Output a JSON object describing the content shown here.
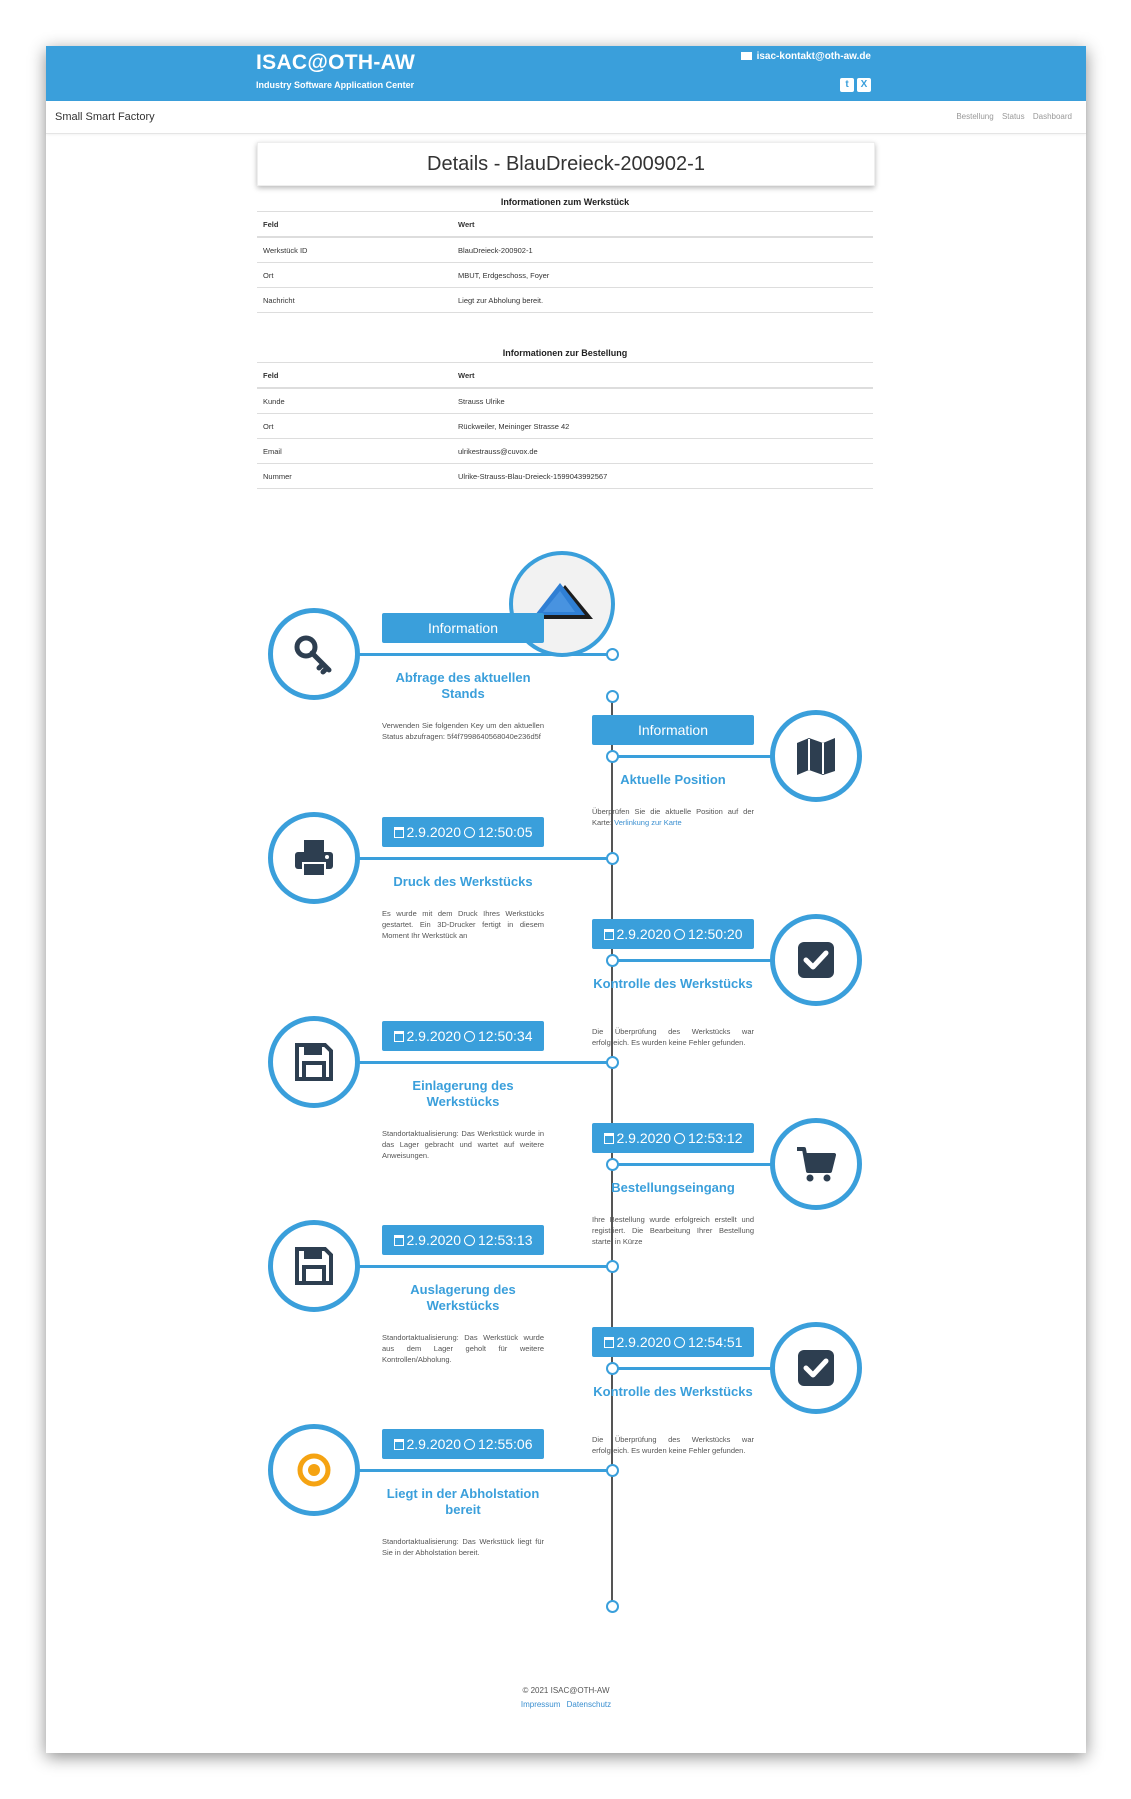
{
  "header": {
    "brand_title": "ISAC@OTH-AW",
    "brand_subtitle": "Industry Software Application Center",
    "contact_email": "isac-kontakt@oth-aw.de",
    "accent_color": "#3a9fdb"
  },
  "navbar": {
    "brand": "Small Smart Factory",
    "links": [
      "Bestellung",
      "Status",
      "Dashboard"
    ]
  },
  "page_title": "Details - BlauDreieck-200902-1",
  "werkstueck_table": {
    "caption": "Informationen zum Werkstück",
    "headers": [
      "Feld",
      "Wert"
    ],
    "rows": [
      [
        "Werkstück ID",
        "BlauDreieck-200902-1"
      ],
      [
        "Ort",
        "MBUT, Erdgeschoss, Foyer"
      ],
      [
        "Nachricht",
        "Liegt zur Abholung bereit."
      ]
    ]
  },
  "bestellung_table": {
    "caption": "Informationen zur Bestellung",
    "headers": [
      "Feld",
      "Wert"
    ],
    "rows": [
      [
        "Kunde",
        "Strauss Ulrike"
      ],
      [
        "Ort",
        "Rückweiler, Meininger Strasse 42"
      ],
      [
        "Email",
        "ulrikestrauss@cuvox.de"
      ],
      [
        "Nummer",
        "Ulrike-Strauss-Blau-Dreieck-1599043992567"
      ]
    ]
  },
  "timeline": [
    {
      "side": "left",
      "badge": "Information",
      "has_time": false,
      "title": "Abfrage des aktuellen Stands",
      "text": "Verwenden Sie folgenden Key um den aktuellen Status abzufragen: 5f4f7998640568040e236d5f",
      "icon": "key-icon"
    },
    {
      "side": "right",
      "badge": "Information",
      "has_time": false,
      "title": "Aktuelle Position",
      "text": "Überprüfen Sie die aktuelle Position auf der Karte:",
      "link": "Verlinkung zur Karte",
      "icon": "map-icon"
    },
    {
      "side": "left",
      "date": "2.9.2020",
      "time": "12:50:05",
      "has_time": true,
      "title": "Druck des Werkstücks",
      "text": "Es wurde mit dem Druck Ihres Werkstücks gestartet. Ein 3D-Drucker fertigt in diesem Moment Ihr Werkstück an",
      "icon": "print-icon"
    },
    {
      "side": "right",
      "date": "2.9.2020",
      "time": "12:50:20",
      "has_time": true,
      "title": "Kontrolle des Werkstücks",
      "text": "Die Überprüfung des Werkstücks war erfolgreich. Es wurden keine Fehler gefunden.",
      "icon": "check-square-icon"
    },
    {
      "side": "left",
      "date": "2.9.2020",
      "time": "12:50:34",
      "has_time": true,
      "title": "Einlagerung des Werkstücks",
      "text": "Standortaktualisierung: Das Werkstück wurde in das Lager gebracht und wartet auf weitere Anweisungen.",
      "icon": "floppy-icon"
    },
    {
      "side": "right",
      "date": "2.9.2020",
      "time": "12:53:12",
      "has_time": true,
      "title": "Bestellungseingang",
      "text": "Ihre Bestellung wurde erfolgreich erstellt und registriert. Die Bearbeitung Ihrer Bestellung startet in Kürze",
      "icon": "cart-icon"
    },
    {
      "side": "left",
      "date": "2.9.2020",
      "time": "12:53:13",
      "has_time": true,
      "title": "Auslagerung des Werkstücks",
      "text": "Standortaktualisierung: Das Werkstück wurde aus dem Lager geholt für weitere Kontrollen/Abholung.",
      "icon": "floppy-icon"
    },
    {
      "side": "right",
      "date": "2.9.2020",
      "time": "12:54:51",
      "has_time": true,
      "title": "Kontrolle des Werkstücks",
      "text": "Die Überprüfung des Werkstücks war erfolgreich. Es wurden keine Fehler gefunden.",
      "icon": "check-square-icon"
    },
    {
      "side": "left",
      "date": "2.9.2020",
      "time": "12:55:06",
      "has_time": true,
      "title": "Liegt in der Abholstation bereit",
      "text": "Standortaktualisierung: Das Werkstück liegt für Sie in der Abholstation bereit.",
      "icon": "target-icon"
    }
  ],
  "footer": {
    "copyright": "© 2021 ISAC@OTH-AW",
    "links": [
      "Impressum",
      "Datenschutz"
    ]
  }
}
